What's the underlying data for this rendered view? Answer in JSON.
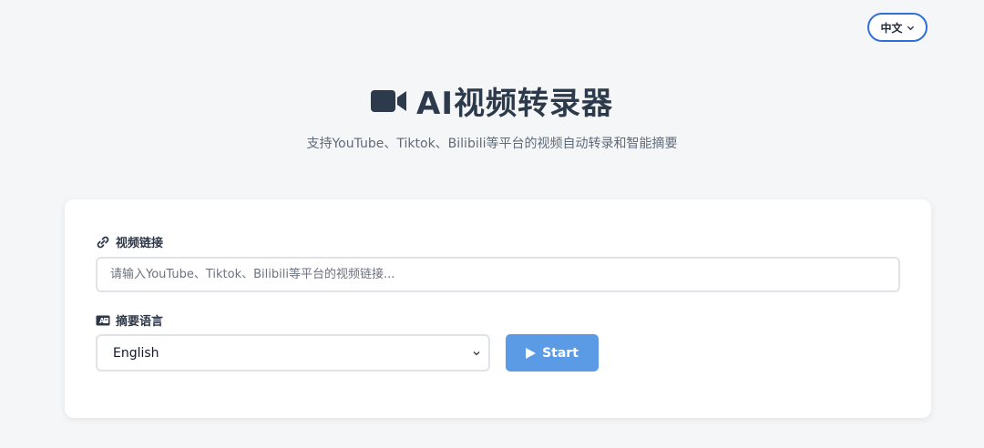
{
  "language_switcher": {
    "label": "中文"
  },
  "header": {
    "title": "AI视频转录器",
    "subtitle": "支持YouTube、Tiktok、Bilibili等平台的视频自动转录和智能摘要"
  },
  "form": {
    "url_label": "视频链接",
    "url_placeholder": "请输入YouTube、Tiktok、Bilibili等平台的视频链接...",
    "url_value": "",
    "language_label": "摘要语言",
    "language_selected": "English",
    "start_label": "Start"
  },
  "colors": {
    "accent": "#2f6fd6",
    "start_button": "#5b9be6",
    "title": "#2d3a4b",
    "background": "#f5f6f8"
  },
  "icons": {
    "title_icon": "video-camera-icon",
    "url_label_icon": "link-icon",
    "language_label_icon": "translate-icon",
    "start_icon": "play-icon",
    "select_icon": "chevron-down-icon"
  }
}
